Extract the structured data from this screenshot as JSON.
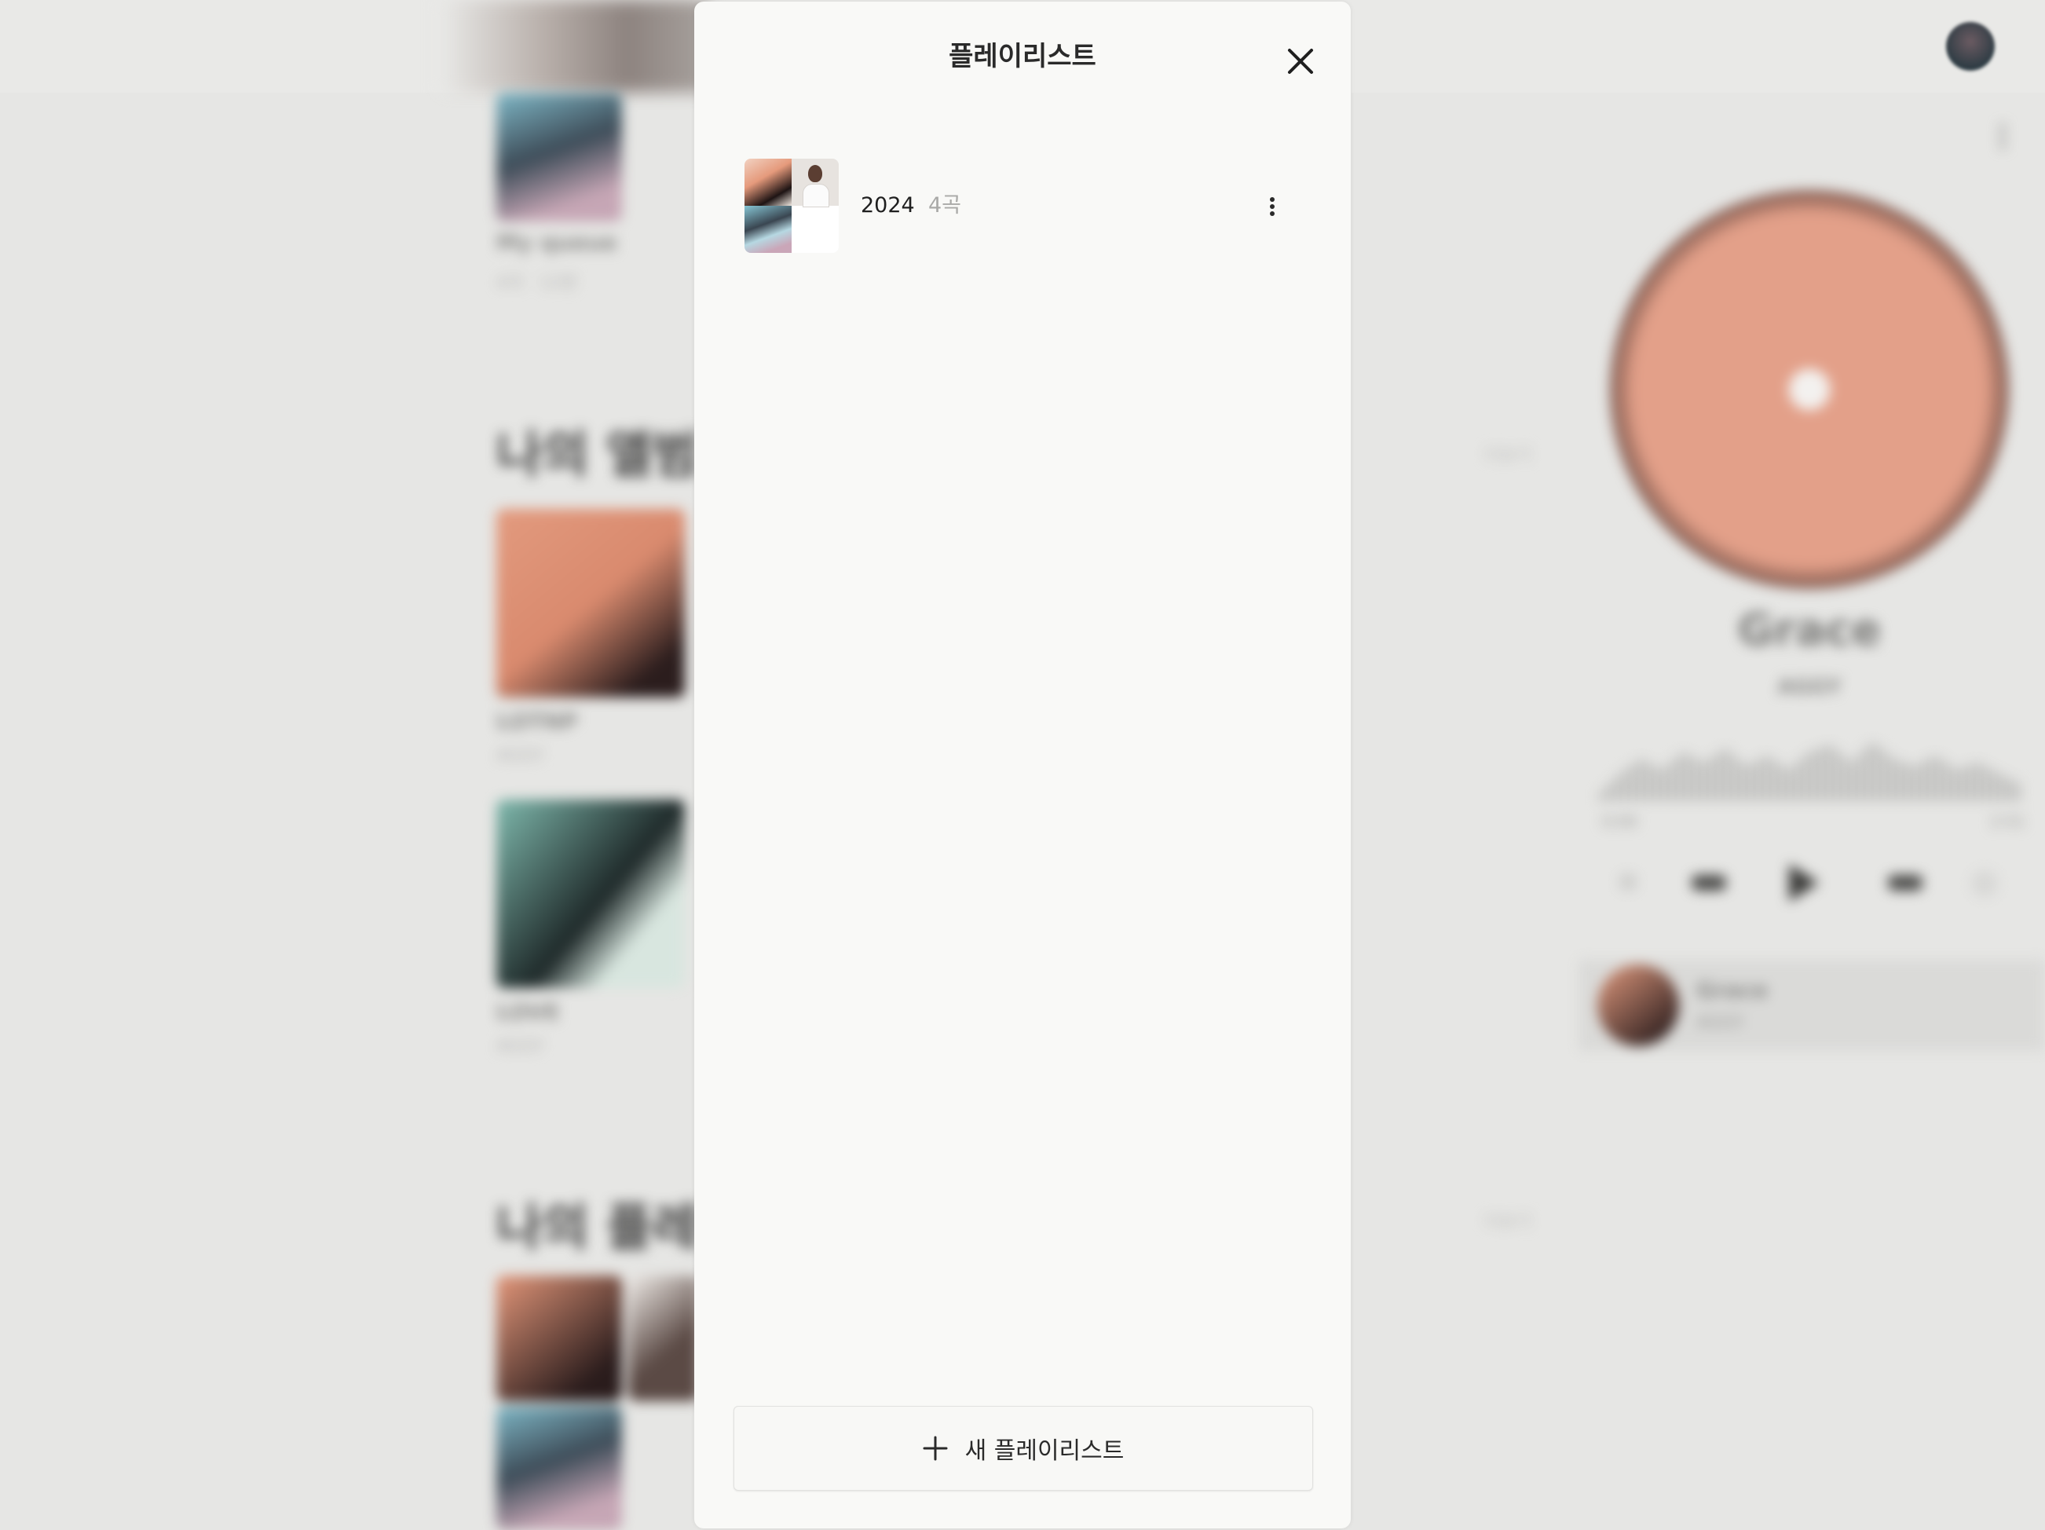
{
  "modal": {
    "title": "플레이리스트",
    "close_icon": "close-icon",
    "playlists": [
      {
        "name": "2024",
        "count": "4곡",
        "more_icon": "more-vertical-icon"
      }
    ],
    "new_playlist": {
      "icon": "plus-icon",
      "label": "새 플레이리스트"
    }
  },
  "background": {
    "queue_title": "My queue",
    "queue_meta": "4곡 · 12분",
    "albums_heading": "나의 앨범",
    "albums": [
      {
        "title": "LOTNP",
        "artist": "AGGY"
      },
      {
        "title": "LOVE",
        "artist": "AGGY"
      }
    ],
    "playlists_heading": "나의 플레이",
    "see_all": "더보기",
    "player": {
      "title": "Grace",
      "artist": "AGGY",
      "time_current": "0:00",
      "time_total": "2:51",
      "queue_item_title": "Grace",
      "queue_item_artist": "AGGY"
    }
  },
  "colors": {
    "modal_bg": "#f9f9f7",
    "page_bg": "#e6e6e4",
    "text_primary": "#1f1f1f",
    "text_muted": "#a9a9a7"
  }
}
